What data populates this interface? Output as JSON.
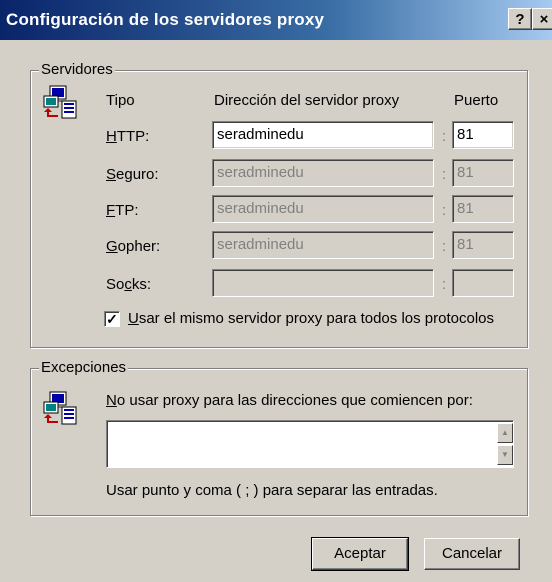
{
  "window": {
    "title": "Configuración de los servidores proxy",
    "help_glyph": "?",
    "close_glyph": "×"
  },
  "servers": {
    "legend": "Servidores",
    "header_type": "Tipo",
    "header_address": "Dirección del servidor proxy",
    "header_port": "Puerto",
    "rows": [
      {
        "key": "H",
        "rest": "TTP:",
        "address": "seradminedu",
        "port": "81",
        "enabled": true
      },
      {
        "key": "S",
        "rest": "eguro:",
        "address": "seradminedu",
        "port": "81",
        "enabled": false
      },
      {
        "key": "F",
        "rest": "TP:",
        "address": "seradminedu",
        "port": "81",
        "enabled": false
      },
      {
        "key": "G",
        "rest": "opher:",
        "address": "seradminedu",
        "port": "81",
        "enabled": false
      },
      {
        "pre": "So",
        "key": "c",
        "rest": "ks:",
        "address": "",
        "port": "",
        "enabled": false
      }
    ],
    "colon": ":",
    "same_proxy": {
      "checked": true,
      "check_glyph": "✓",
      "key": "U",
      "rest": "sar el mismo servidor proxy para todos los protocolos"
    },
    "icon": "network-computers-icon"
  },
  "exceptions": {
    "legend": "Excepciones",
    "key": "N",
    "rest": "o usar proxy para las direcciones que comiencen por:",
    "value": "",
    "hint": "Usar punto y coma ( ; ) para separar las entradas.",
    "icon": "network-computers-icon",
    "scroll_up_glyph": "▲",
    "scroll_down_glyph": "▼"
  },
  "buttons": {
    "ok": "Aceptar",
    "cancel": "Cancelar"
  }
}
